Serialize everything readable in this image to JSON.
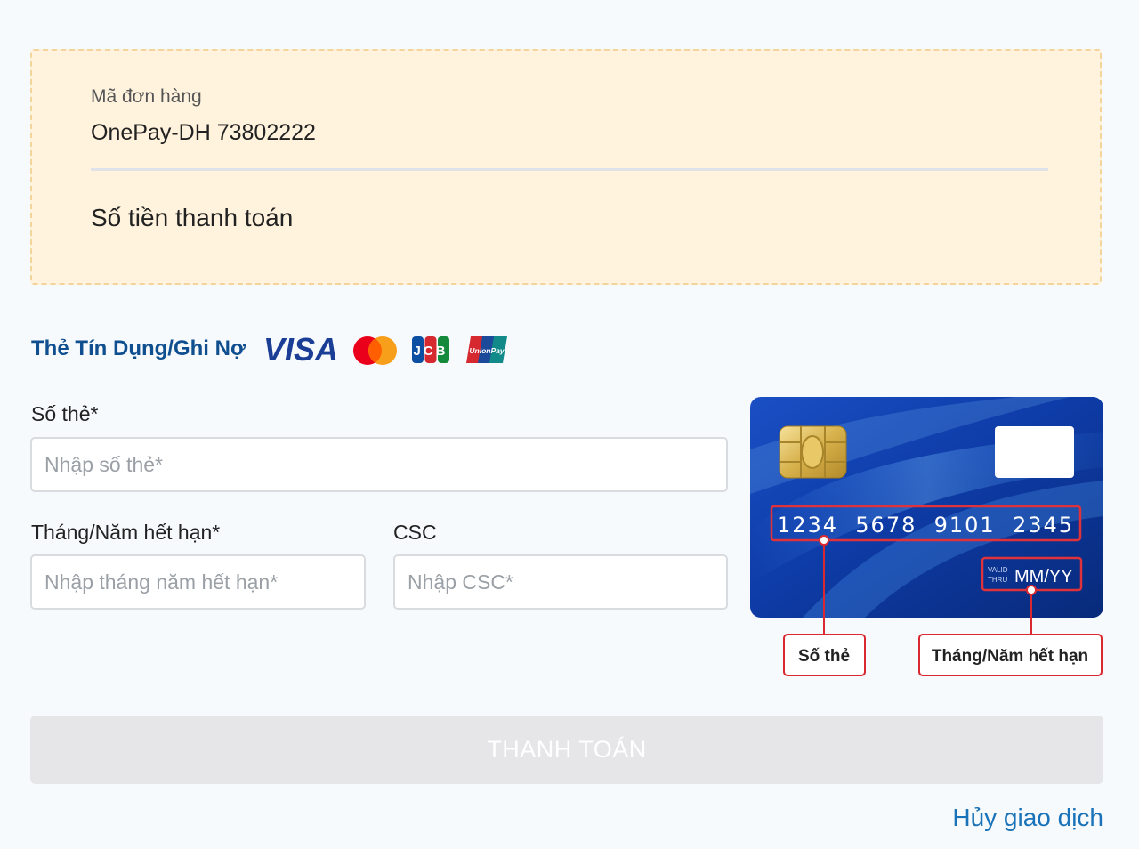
{
  "order": {
    "id_label": "Mã đơn hàng",
    "id_value": "OnePay-DH 73802222",
    "amount_label": "Số tiền thanh toán"
  },
  "payment_method": {
    "title": "Thẻ Tín Dụng/Ghi Nợ",
    "logos": [
      "VISA",
      "Mastercard",
      "JCB",
      "UnionPay"
    ]
  },
  "form": {
    "card_number_label": "Số thẻ*",
    "card_number_placeholder": "Nhập số thẻ*",
    "expiry_label": "Tháng/Năm hết hạn*",
    "expiry_placeholder": "Nhập tháng năm hết hạn*",
    "csc_label": "CSC",
    "csc_placeholder": "Nhập CSC*"
  },
  "card_illustration": {
    "number": "1234  5678  9101  2345",
    "valid_thru_1": "VALID",
    "valid_thru_2": "THRU",
    "expiry": "MM/YY",
    "callout_number": "Số thẻ",
    "callout_expiry": "Tháng/Năm hết hạn"
  },
  "actions": {
    "pay_label": "THANH TOÁN",
    "cancel_label": "Hủy giao dịch"
  },
  "colors": {
    "accent": "#0f4f8f",
    "link": "#1a73b8",
    "order_box_bg": "#fff3de",
    "callout_red": "#d9282f",
    "button_disabled": "#e6e6e8"
  }
}
